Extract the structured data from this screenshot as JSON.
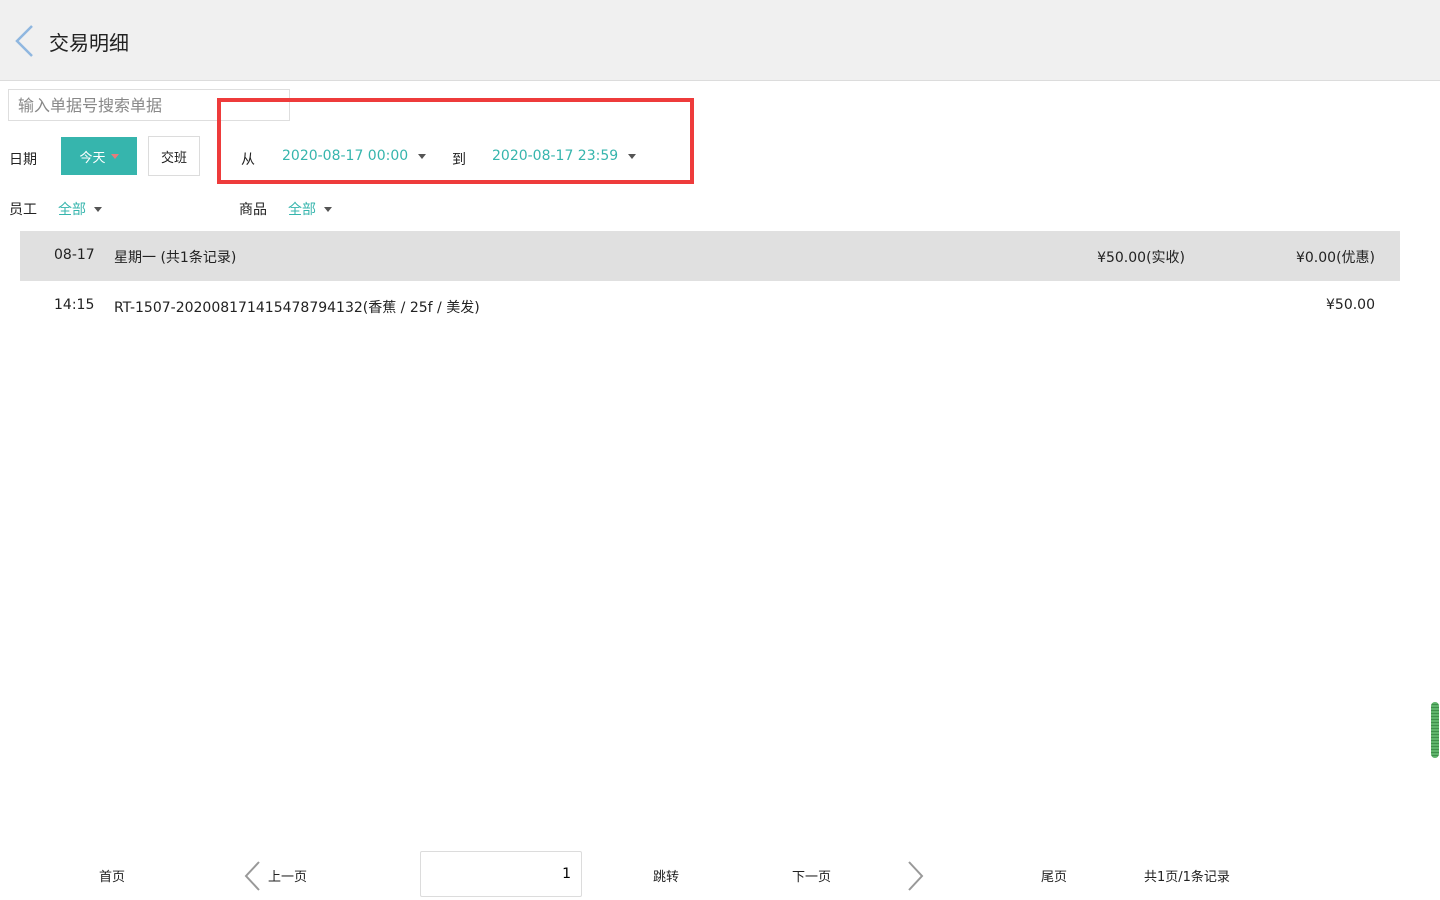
{
  "header": {
    "title": "交易明细"
  },
  "search": {
    "placeholder": "输入单据号搜索单据"
  },
  "filters": {
    "date_label": "日期",
    "today_label": "今天",
    "shift_label": "交班",
    "from_label": "从",
    "from_value": "2020-08-17 00:00",
    "to_label": "到",
    "to_value": "2020-08-17 23:59",
    "staff_label": "员工",
    "staff_value": "全部",
    "product_label": "商品",
    "product_value": "全部"
  },
  "day_group": {
    "date": "08-17",
    "summary": "星期一 (共1条记录)",
    "received": "¥50.00(实收)",
    "discount": "¥0.00(优惠)"
  },
  "records": [
    {
      "time": "14:15",
      "desc": "RT-1507-20200817141547879413​2(香蕉 / 25f / 美发)",
      "amount": "¥50.00"
    }
  ],
  "pager": {
    "first": "首页",
    "prev": "上一页",
    "page": "1",
    "jump": "跳转",
    "next": "下一页",
    "last": "尾页",
    "summary": "共1页/1条记录"
  },
  "colors": {
    "accent": "#36b5ad",
    "highlight": "#ee3b3b",
    "header_bg": "#f0f0f0",
    "group_bg": "#e0e0e0"
  }
}
